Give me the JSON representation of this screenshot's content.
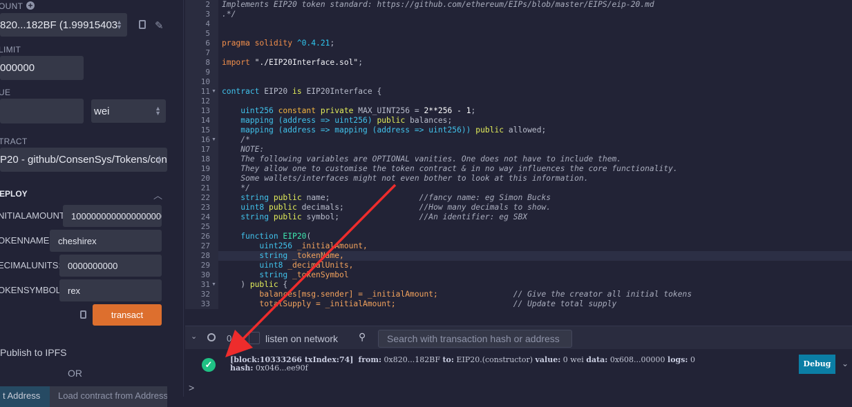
{
  "sidebar": {
    "account_label": "OUNT",
    "account_value": "820...182BF (1.99915403",
    "gas_limit_label": "LIMIT",
    "gas_limit_value": "000000",
    "value_label": "UE",
    "value_value": "",
    "value_unit": "wei",
    "contract_label": "TRACT",
    "contract_value": "P20 - github/ConsenSys/Tokens/cont",
    "deploy_label": "EPLOY",
    "params": [
      {
        "label": "NITIALAMOUNT:",
        "value": "1000000000000000000"
      },
      {
        "label": "OKENNAME:",
        "value": "cheshirex"
      },
      {
        "label": "ECIMALUNITS:",
        "value": "0000000000"
      },
      {
        "label": "OKENSYMBOL:",
        "value": "rex"
      }
    ],
    "transact_label": "transact",
    "publish_label": "Publish to IPFS",
    "or_label": "OR",
    "at_address_label": "t Address",
    "load_contract_placeholder": "Load contract from Address"
  },
  "editor": {
    "highlighted_line": 28,
    "lines": [
      {
        "n": 2,
        "t": [
          [
            "Implements EIP20 token standard: https://github.com/ethereum/EIPs/blob/master/EIPS/eip-20.md",
            "c"
          ]
        ]
      },
      {
        "n": 3,
        "t": [
          [
            ".*/",
            "c"
          ]
        ]
      },
      {
        "n": 4,
        "t": []
      },
      {
        "n": 5,
        "t": []
      },
      {
        "n": 6,
        "t": [
          [
            "pragma solidity ",
            "k"
          ],
          [
            "^0.4.21",
            "v"
          ],
          [
            ";",
            "p"
          ]
        ]
      },
      {
        "n": 7,
        "t": []
      },
      {
        "n": 8,
        "t": [
          [
            "import ",
            "k"
          ],
          [
            "\"./EIP20Interface.sol\"",
            "s"
          ],
          [
            ";",
            "p"
          ]
        ]
      },
      {
        "n": 9,
        "t": []
      },
      {
        "n": 10,
        "t": []
      },
      {
        "n": 11,
        "fold": true,
        "t": [
          [
            "contract ",
            "kw"
          ],
          [
            "EIP20 ",
            "p"
          ],
          [
            "is ",
            "y"
          ],
          [
            "EIP20Interface {",
            "p"
          ]
        ]
      },
      {
        "n": 12,
        "t": []
      },
      {
        "n": 13,
        "t": [
          [
            "    uint256 ",
            "kw"
          ],
          [
            "constant ",
            "o"
          ],
          [
            "private ",
            "y"
          ],
          [
            "MAX_UINT256 = ",
            "p"
          ],
          [
            "2**256 - 1",
            "n"
          ],
          [
            ";",
            "p"
          ]
        ]
      },
      {
        "n": 14,
        "t": [
          [
            "    mapping (address => uint256) ",
            "kw"
          ],
          [
            "public ",
            "y"
          ],
          [
            "balances;",
            "p"
          ]
        ]
      },
      {
        "n": 15,
        "t": [
          [
            "    mapping (address => mapping (address => uint256)) ",
            "kw"
          ],
          [
            "public ",
            "y"
          ],
          [
            "allowed;",
            "p"
          ]
        ]
      },
      {
        "n": 16,
        "fold": true,
        "t": [
          [
            "    /*",
            "c"
          ]
        ]
      },
      {
        "n": 17,
        "t": [
          [
            "    NOTE:",
            "c"
          ]
        ]
      },
      {
        "n": 18,
        "t": [
          [
            "    The following variables are OPTIONAL vanities. One does not have to include them.",
            "c"
          ]
        ]
      },
      {
        "n": 19,
        "t": [
          [
            "    They allow one to customise the token contract & in no way influences the core functionality.",
            "c"
          ]
        ]
      },
      {
        "n": 20,
        "t": [
          [
            "    Some wallets/interfaces might not even bother to look at this information.",
            "c"
          ]
        ]
      },
      {
        "n": 21,
        "t": [
          [
            "    */",
            "c"
          ]
        ]
      },
      {
        "n": 22,
        "t": [
          [
            "    string ",
            "kw"
          ],
          [
            "public ",
            "y"
          ],
          [
            "name;                   ",
            "p"
          ],
          [
            "//fancy name: eg Simon Bucks",
            "c"
          ]
        ]
      },
      {
        "n": 23,
        "t": [
          [
            "    uint8 ",
            "kw"
          ],
          [
            "public ",
            "y"
          ],
          [
            "decimals;                ",
            "p"
          ],
          [
            "//How many decimals to show.",
            "c"
          ]
        ]
      },
      {
        "n": 24,
        "t": [
          [
            "    string ",
            "kw"
          ],
          [
            "public ",
            "y"
          ],
          [
            "symbol;                 ",
            "p"
          ],
          [
            "//An identifier: eg SBX",
            "c"
          ]
        ]
      },
      {
        "n": 25,
        "t": []
      },
      {
        "n": 26,
        "t": [
          [
            "    function ",
            "kw"
          ],
          [
            "EIP20",
            "f"
          ],
          [
            "(",
            "p"
          ]
        ]
      },
      {
        "n": 27,
        "t": [
          [
            "        uint256 ",
            "kw"
          ],
          [
            "_initialAmount,",
            "m"
          ]
        ]
      },
      {
        "n": 28,
        "t": [
          [
            "        string ",
            "kw"
          ],
          [
            "_tokenName,",
            "m"
          ]
        ]
      },
      {
        "n": 29,
        "t": [
          [
            "        uint8 ",
            "kw"
          ],
          [
            "_decimalUnits,",
            "m"
          ]
        ]
      },
      {
        "n": 30,
        "t": [
          [
            "        string ",
            "kw"
          ],
          [
            "_tokenSymbol",
            "m"
          ]
        ]
      },
      {
        "n": 31,
        "fold": true,
        "t": [
          [
            "    ) ",
            "p"
          ],
          [
            "public ",
            "y"
          ],
          [
            "{",
            "p"
          ]
        ]
      },
      {
        "n": 32,
        "t": [
          [
            "        balances[msg.sender] = _initialAmount;                ",
            "m"
          ],
          [
            "// Give the creator all initial tokens",
            "c"
          ]
        ]
      },
      {
        "n": 33,
        "t": [
          [
            "        totalSupply = _initialAmount;                         ",
            "m"
          ],
          [
            "// Update total supply",
            "c"
          ]
        ]
      }
    ]
  },
  "terminal": {
    "pending_count": "0",
    "listen_label": "listen on network",
    "search_placeholder": "Search with transaction hash or address",
    "log": {
      "block": "[block:10333266 txIndex:74]",
      "from_label": "from:",
      "from": "0x820...182BF",
      "to_label": "to:",
      "to": "EIP20.(constructor)",
      "value_label": "value:",
      "value": "0 wei",
      "data_label": "data:",
      "data": "0x608...00000",
      "logs_label": "logs:",
      "logs": "0",
      "hash_label": "hash:",
      "hash": "0x046...ee90f"
    },
    "debug_label": "Debug",
    "prompt": ">"
  },
  "colors": {
    "transact": "#dd6f2e",
    "debug": "#0b7ea5",
    "success": "#1fc184",
    "arrow": "#ee2c2c"
  }
}
